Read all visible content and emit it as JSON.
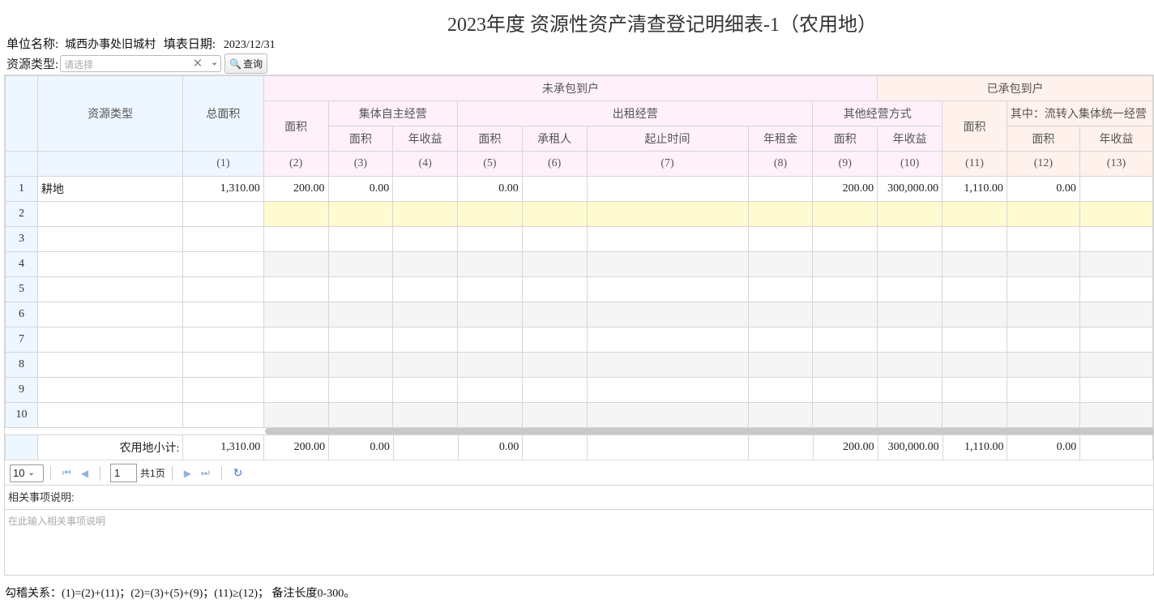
{
  "title": "2023年度 资源性资产清查登记明细表-1（农用地）",
  "info": {
    "unit_label": "单位名称:",
    "unit_value": "城西办事处旧城村",
    "date_label": "填表日期:",
    "date_value": "2023/12/31"
  },
  "filter": {
    "label": "资源类型:",
    "placeholder": "请选择",
    "query_label": "查询"
  },
  "headers": {
    "resource_type": "资源类型",
    "total_area": "总面积",
    "not_contracted": "未承包到户",
    "area": "面积",
    "collective_self": "集体自主经营",
    "annual_income": "年收益",
    "lease": "出租经营",
    "lessee": "承租人",
    "period": "起止时间",
    "annual_rent": "年租金",
    "other": "其他经营方式",
    "contracted": "已承包到户",
    "transfer": "其中：流转入集体统一经营",
    "idx": [
      "(1)",
      "(2)",
      "(3)",
      "(4)",
      "(5)",
      "(6)",
      "(7)",
      "(8)",
      "(9)",
      "(10)",
      "(11)",
      "(12)",
      "(13)"
    ]
  },
  "rows": [
    {
      "no": "1",
      "type": "耕地",
      "c1": "1,310.00",
      "c2": "200.00",
      "c3": "0.00",
      "c4": "",
      "c5": "0.00",
      "c6": "",
      "c7": "",
      "c8": "",
      "c9": "200.00",
      "c10": "300,000.00",
      "c11": "1,110.00",
      "c12": "0.00",
      "c13": ""
    },
    {
      "no": "2"
    },
    {
      "no": "3"
    },
    {
      "no": "4"
    },
    {
      "no": "5"
    },
    {
      "no": "6"
    },
    {
      "no": "7"
    },
    {
      "no": "8"
    },
    {
      "no": "9"
    },
    {
      "no": "10"
    }
  ],
  "subtotal": {
    "label": "农用地小计:",
    "c1": "1,310.00",
    "c2": "200.00",
    "c3": "0.00",
    "c5": "0.00",
    "c9": "200.00",
    "c10": "300,000.00",
    "c11": "1,110.00",
    "c12": "0.00"
  },
  "pager": {
    "page_size": "10",
    "page": "1",
    "total_text": "共1页"
  },
  "notes": {
    "label": "相关事项说明:",
    "placeholder": "在此输入相关事项说明"
  },
  "footer": "勾稽关系：(1)=(2)+(11)；(2)=(3)+(5)+(9)；(11)≥(12)；  备注长度0-300。"
}
